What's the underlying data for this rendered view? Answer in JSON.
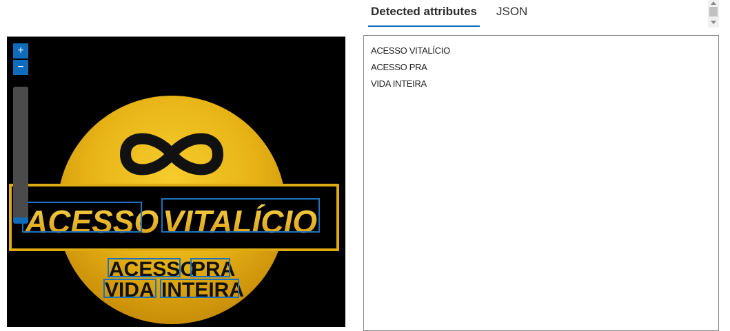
{
  "tabs": [
    {
      "label": "Detected attributes",
      "active": true
    },
    {
      "label": "JSON",
      "active": false
    }
  ],
  "viewer": {
    "zoom_in_label": "+",
    "zoom_out_label": "−",
    "image_text": {
      "line1_word1": "ACESSO",
      "line1_word2": "VITALÍCIO",
      "line2_word1": "ACESSO",
      "line2_word2": "PRA",
      "line3_word1": "VIDA",
      "line3_word2": "INTEIRA"
    }
  },
  "detected_attributes": [
    "ACESSO VITALÍCIO",
    "ACESSO PRA",
    "VIDA INTEIRA"
  ],
  "colors": {
    "accent": "#0f6cbd",
    "box": "#1e73be",
    "gold": "#e7b416",
    "dark_gold": "#c98d08"
  }
}
